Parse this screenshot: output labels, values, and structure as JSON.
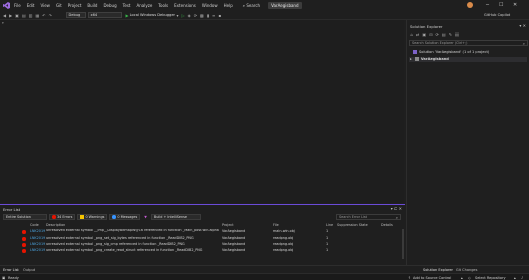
{
  "menubar": {
    "items": [
      "File",
      "Edit",
      "View",
      "Git",
      "Project",
      "Build",
      "Debug",
      "Test",
      "Analyze",
      "Tools",
      "Extensions",
      "Window",
      "Help"
    ],
    "search_label": "Search",
    "project_name": "VarAegisband",
    "github_copilot": "GitHub Copilot"
  },
  "toolbar": {
    "configuration": "Debug",
    "platform": "x64",
    "run_label": "Local Windows Debugger"
  },
  "solution_explorer": {
    "title": "Solution Explorer",
    "search_placeholder": "Search Solution Explorer (Ctrl+;)",
    "solution_line": "Solution 'VarAegisband' (1 of 1 project)",
    "project_line": "VarAegisband"
  },
  "error_list": {
    "title": "Error List",
    "scope": "Entire Solution",
    "errors_label": "34 Errors",
    "warnings_label": "0 Warnings",
    "messages_label": "0 Messages",
    "build_filter": "Build + IntelliSense",
    "search_placeholder": "Search Error List",
    "columns": [
      "Code",
      "Description",
      "Project",
      "File",
      "Line",
      "Suppression State",
      "Details"
    ],
    "rows": [
      {
        "code": "LNK2019",
        "description": "unresolved external symbol __imp__DisplayBitmapW@16 referenced in function _Main_post.win.alpha",
        "project": "VarAegisband",
        "file": "main-win.obj",
        "line": "1"
      },
      {
        "code": "LNK2019",
        "description": "unresolved external symbol _png_set_sig_bytes referenced in function _ReadDIB2_PNG",
        "project": "VarAegisband",
        "file": "readpng.obj",
        "line": "1"
      },
      {
        "code": "LNK2019",
        "description": "unresolved external symbol _png_sig_cmp referenced in function _ReadDIB2_PNG",
        "project": "VarAegisband",
        "file": "readpng.obj",
        "line": "1"
      },
      {
        "code": "LNK2019",
        "description": "unresolved external symbol _png_create_read_struct referenced in function _ReadDIB2_PNG",
        "project": "VarAegisband",
        "file": "readpng.obj",
        "line": "1"
      }
    ]
  },
  "bottom_tabs": {
    "left": [
      "Error List",
      "Output"
    ],
    "right": [
      "Solution Explorer",
      "Git Changes"
    ]
  },
  "status": {
    "ready": "Ready",
    "add_source": "Add to Source Control",
    "select_repo": "Select Repository"
  },
  "colors": {
    "accent": "#6b4bd8",
    "error": "#e51400",
    "warning": "#f5c400",
    "info": "#3794ff",
    "run": "#39b54a"
  }
}
